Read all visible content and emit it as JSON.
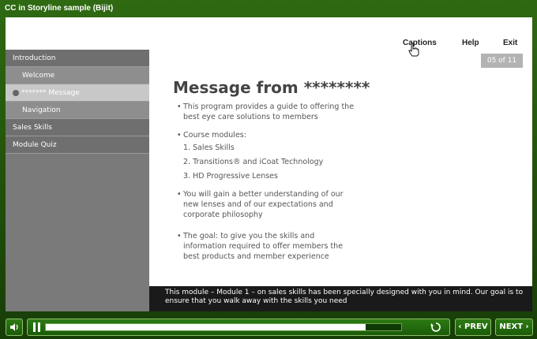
{
  "window": {
    "title": "CC in Storyline sample (Bijit)"
  },
  "top_nav": {
    "captions": "Captions",
    "help": "Help",
    "exit": "Exit"
  },
  "slide_counter": "05  of 11",
  "menu": {
    "items": [
      {
        "label": "Introduction"
      },
      {
        "label": "Welcome"
      },
      {
        "label": "******* Message"
      },
      {
        "label": "Navigation"
      },
      {
        "label": "Sales Skills"
      },
      {
        "label": "Module Quiz"
      }
    ]
  },
  "slide": {
    "heading": "Message from ********",
    "bullet1": "This program provides a guide to offering the best eye care solutions to members",
    "bullet2": "Course modules:",
    "modules": [
      "1. Sales Skills",
      "2. Transitions® and iCoat Technology",
      "3. HD Progressive Lenses"
    ],
    "bullet3": "You will gain a better understanding of our new lenses and of our expectations and corporate philosophy",
    "bullet4": "The goal: to give you the skills and information required to offer members the best products and member experience"
  },
  "caption_text": "This module – Module 1 – on sales skills has been specially designed with you in mind. Our goal is to ensure that you walk away with the skills you need",
  "player": {
    "prev_label": "PREV",
    "next_label": "NEXT",
    "progress": 0.9
  },
  "icons": {
    "volume": "volume-icon",
    "pause": "pause-icon",
    "replay": "replay-icon",
    "cursor": "hand-cursor-icon"
  }
}
